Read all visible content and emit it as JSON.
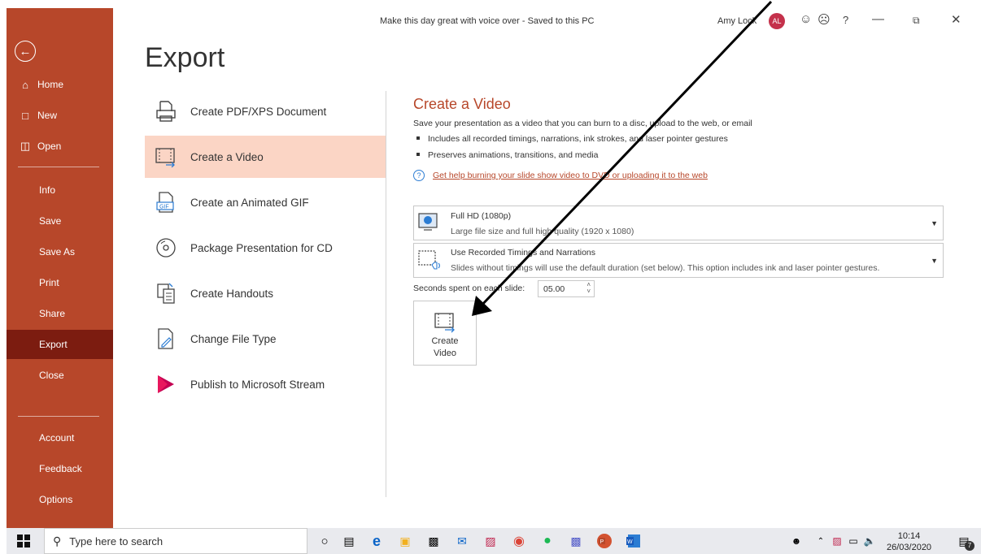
{
  "window": {
    "title": "Make this day great with voice over  -  Saved to this PC",
    "user_name": "Amy Lock",
    "user_initials": "AL"
  },
  "sidebar": {
    "items": [
      {
        "label": "Home",
        "icon": "home-icon"
      },
      {
        "label": "New",
        "icon": "new-document-icon"
      },
      {
        "label": "Open",
        "icon": "folder-open-icon"
      },
      {
        "label": "Info"
      },
      {
        "label": "Save"
      },
      {
        "label": "Save As"
      },
      {
        "label": "Print"
      },
      {
        "label": "Share"
      },
      {
        "label": "Export",
        "active": true
      },
      {
        "label": "Close"
      },
      {
        "label": "Account"
      },
      {
        "label": "Feedback"
      },
      {
        "label": "Options"
      }
    ]
  },
  "main": {
    "title": "Export",
    "options": [
      {
        "label": "Create PDF/XPS Document",
        "icon": "pdf-document-icon"
      },
      {
        "label": "Create a Video",
        "icon": "video-icon",
        "active": true
      },
      {
        "label": "Create an Animated GIF",
        "icon": "gif-icon"
      },
      {
        "label": "Package Presentation for CD",
        "icon": "cd-icon"
      },
      {
        "label": "Create Handouts",
        "icon": "handouts-icon"
      },
      {
        "label": "Change File Type",
        "icon": "change-file-type-icon"
      },
      {
        "label": "Publish to Microsoft Stream",
        "icon": "microsoft-stream-icon"
      }
    ]
  },
  "panel": {
    "title": "Create a Video",
    "description": "Save your presentation as a video that you can burn to a disc, upload to the web, or email",
    "bullets": [
      "Includes all recorded timings, narrations, ink strokes, and laser pointer gestures",
      "Preserves animations, transitions, and media"
    ],
    "help_link": "Get help burning your slide show video to DVD or uploading it to the web",
    "quality": {
      "title": "Full HD (1080p)",
      "subtitle": "Large file size and full high quality (1920 x 1080)"
    },
    "timings": {
      "title": "Use Recorded Timings and Narrations",
      "subtitle": "Slides without timings will use the default duration (set below). This option includes ink and laser pointer gestures."
    },
    "seconds_label": "Seconds spent on each slide:",
    "seconds_value": "05.00",
    "create_button": {
      "line1": "Create",
      "line2": "Video"
    }
  },
  "taskbar": {
    "search_placeholder": "Type here to search",
    "time": "10:14",
    "date": "26/03/2020",
    "notification_count": "7"
  },
  "colors": {
    "accent": "#b7472a",
    "sidebar_active": "#7c1c10",
    "option_active": "#fbd5c5",
    "link": "#2b7cd3"
  }
}
